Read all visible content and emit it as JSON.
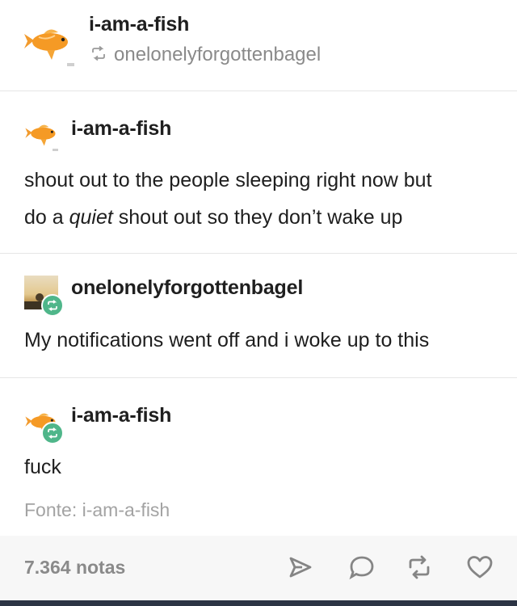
{
  "header": {
    "username": "i-am-a-fish",
    "reblogged_from": "onelonelyforgottenbagel",
    "reblog_icon": "reblog-icon"
  },
  "posts": [
    {
      "username": "i-am-a-fish",
      "text_line1": "shout out to the people sleeping right now but",
      "text_line2_prefix": "do a ",
      "text_line2_emph": "quiet",
      "text_line2_suffix": " shout out so they don’t wake up"
    },
    {
      "username": "onelonelyforgottenbagel",
      "text": "My notifications went off and i woke up to this"
    },
    {
      "username": "i-am-a-fish",
      "text": "fuck"
    }
  ],
  "source": "Fonte: i-am-a-fish",
  "footer": {
    "notes": "7.364 notas",
    "icons": [
      "send-icon",
      "reply-icon",
      "reblog-icon",
      "like-icon"
    ]
  },
  "colors": {
    "reblog_green": "#4fb68a",
    "icon_gray": "#858585",
    "divider": "#e6e6e6"
  }
}
